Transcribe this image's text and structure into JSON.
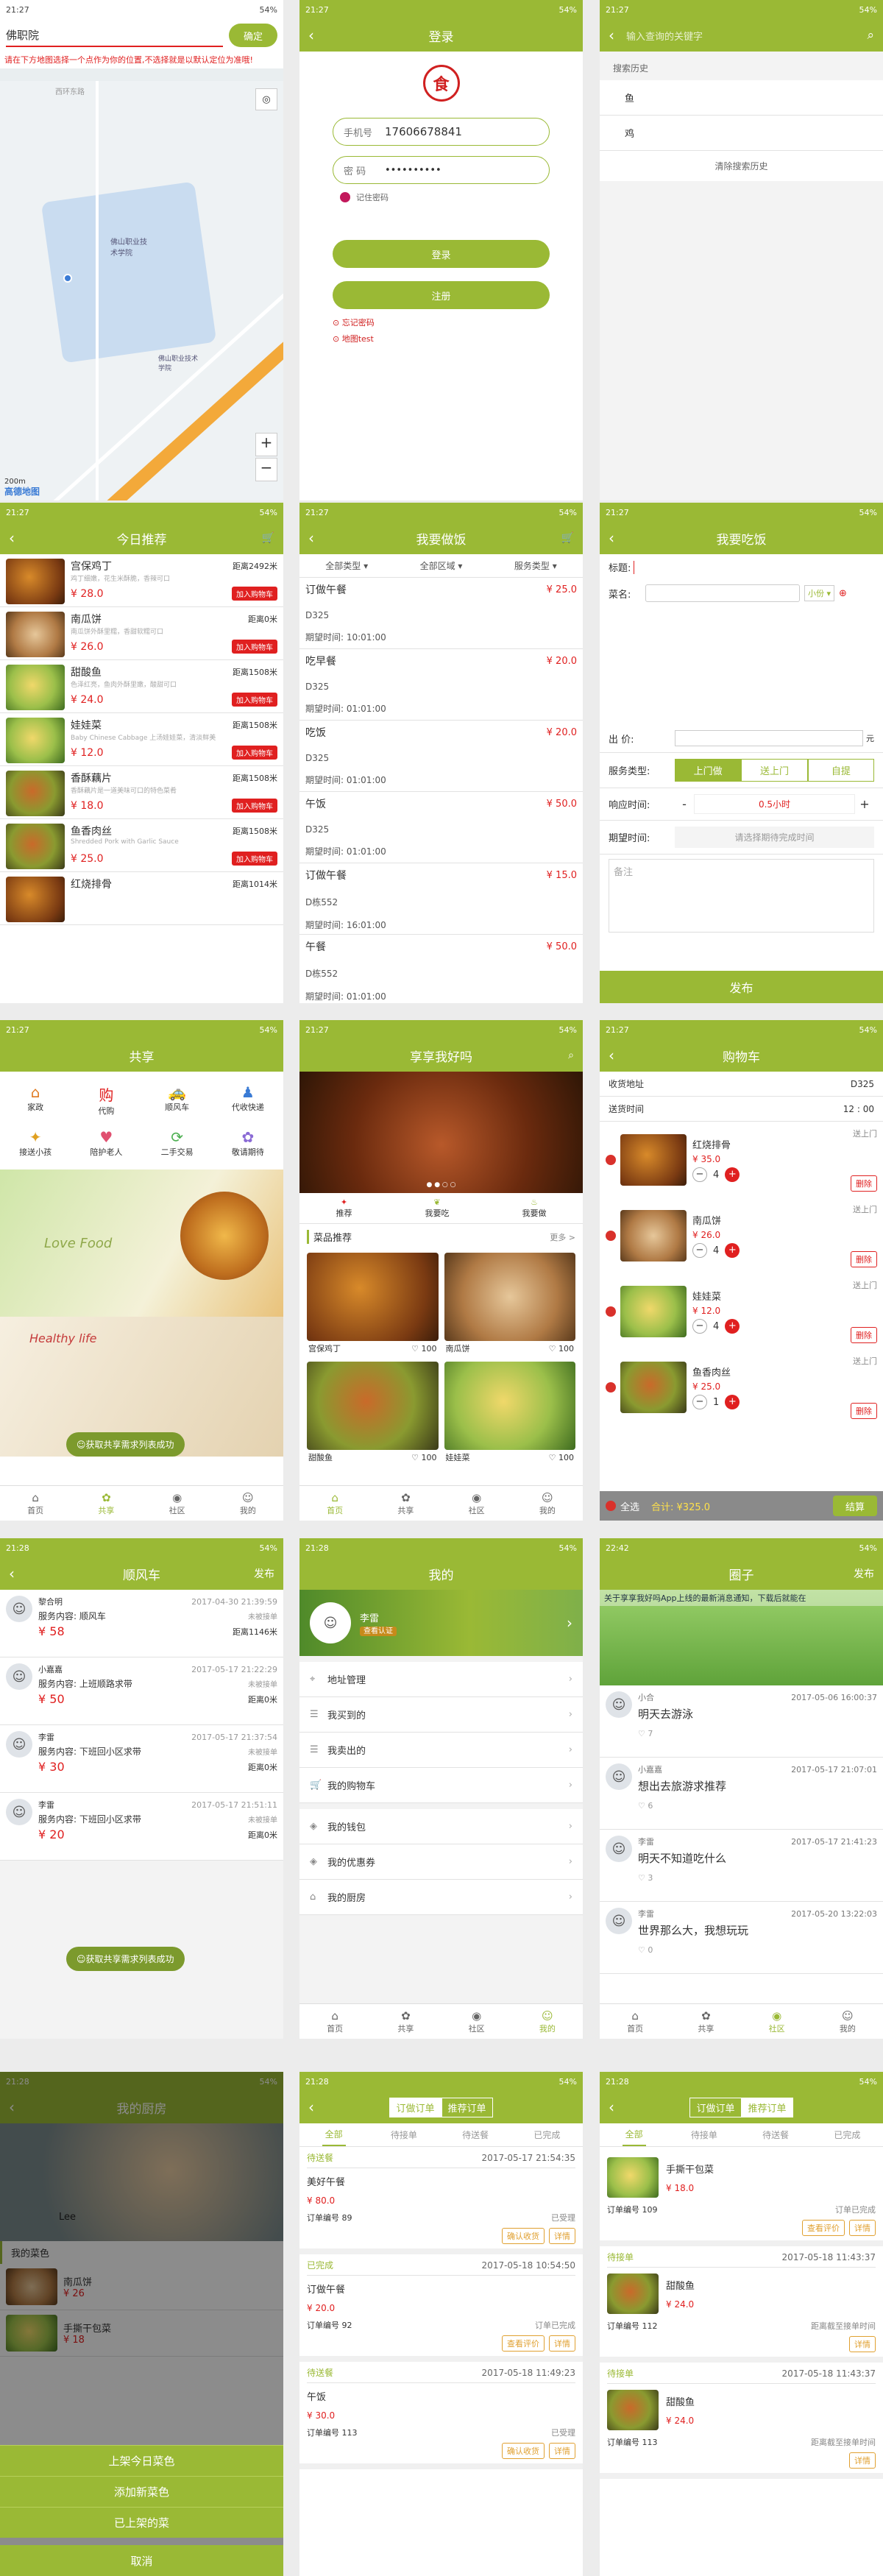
{
  "status": {
    "time": "21:27",
    "battery": "54%",
    "time2": "21:28",
    "time3": "22:42"
  },
  "map": {
    "place": "佛职院",
    "confirm": "确定",
    "hint": "请在下方地图选择一个点作为你的位置,不选择就是以默认定位为准哦!",
    "campus": "佛山职业技术学院",
    "street": "西环东路",
    "scale": "200m",
    "logo": "高德地图",
    "zoom_in": "+",
    "zoom_out": "−",
    "poi": "佛山职业技术学院"
  },
  "login": {
    "title": "登录",
    "phone_label": "手机号",
    "phone": "17606678841",
    "pwd_label": "密 码",
    "pwd": "••••••••••",
    "remember": "记住密码",
    "login_btn": "登录",
    "register_btn": "注册",
    "forgot": "忘记密码",
    "maptest": "地图test",
    "logo": "食"
  },
  "search": {
    "placeholder": "输入查询的关键字",
    "history_title": "搜索历史",
    "items": [
      "鱼",
      "鸡"
    ],
    "clear": "清除搜索历史"
  },
  "rec": {
    "title": "今日推荐",
    "items": [
      {
        "name": "宫保鸡丁",
        "dist": "距离2492米",
        "desc": "鸡丁细嫩，花生米酥脆，香辣可口",
        "price": "¥ 28.0",
        "add": "加入购物车"
      },
      {
        "name": "南瓜饼",
        "dist": "距离0米",
        "desc": "南瓜饼外酥里糯，香甜软糯可口",
        "price": "¥ 26.0",
        "add": "加入购物车"
      },
      {
        "name": "甜酸鱼",
        "dist": "距离1508米",
        "desc": "色泽红亮，鱼肉外酥里嫩，酸甜可口",
        "price": "¥ 24.0",
        "add": "加入购物车"
      },
      {
        "name": "娃娃菜",
        "dist": "距离1508米",
        "desc": "Baby Chinese Cabbage 上汤娃娃菜，清淡鲜美",
        "price": "¥ 12.0",
        "add": "加入购物车"
      },
      {
        "name": "香酥藕片",
        "dist": "距离1508米",
        "desc": "香酥藕片是一道美味可口的特色菜肴",
        "price": "¥ 18.0",
        "add": "加入购物车"
      },
      {
        "name": "鱼香肉丝",
        "dist": "距离1508米",
        "desc": "Shredded Pork with Garlic Sauce",
        "price": "¥ 25.0",
        "add": "加入购物车"
      },
      {
        "name": "红烧排骨",
        "dist": "距离1014米",
        "desc": "",
        "price": "",
        "add": ""
      }
    ]
  },
  "cook": {
    "title": "我要做饭",
    "filters": [
      "全部类型",
      "全部区域",
      "服务类型"
    ],
    "items": [
      {
        "name": "订做午餐",
        "price": "¥ 25.0",
        "room": "D325",
        "time": "期望时间:  10:01:00"
      },
      {
        "name": "吃早餐",
        "price": "¥ 20.0",
        "room": "D325",
        "time": "期望时间:  01:01:00"
      },
      {
        "name": "吃饭",
        "price": "¥ 20.0",
        "room": "D325",
        "time": "期望时间:  01:01:00"
      },
      {
        "name": "午饭",
        "price": "¥ 50.0",
        "room": "D325",
        "time": "期望时间:  01:01:00"
      },
      {
        "name": "订做午餐",
        "price": "¥ 15.0",
        "room": "D栋552",
        "time": "期望时间:  16:01:00"
      },
      {
        "name": "午餐",
        "price": "¥ 50.0",
        "room": "D栋552",
        "time": "期望时间:  01:01:00"
      }
    ]
  },
  "eat": {
    "title": "我要吃饭",
    "title_label": "标题:",
    "dish_label": "菜名:",
    "portion": "小份",
    "price_label": "出    价:",
    "unit": "元",
    "service_label": "服务类型:",
    "services": [
      "上门做",
      "送上门",
      "自提"
    ],
    "resp_label": "响应时间:",
    "resp_value": "0.5小时",
    "minus": "-",
    "plus": "+",
    "expect_label": "期望时间:",
    "expect_placeholder": "请选择期待完成时间",
    "note_placeholder": "备注",
    "publish": "发布"
  },
  "share": {
    "title": "共享",
    "icons": [
      {
        "label": "家政",
        "icon": "⌂"
      },
      {
        "label": "代购",
        "icon": "购"
      },
      {
        "label": "顺风车",
        "icon": "🚕"
      },
      {
        "label": "代收快递",
        "icon": "♟"
      },
      {
        "label": "接送小孩",
        "icon": "✦"
      },
      {
        "label": "陪护老人",
        "icon": "♥"
      },
      {
        "label": "二手交易",
        "icon": "⟳"
      },
      {
        "label": "敬请期待",
        "icon": "✿"
      }
    ],
    "banner1": "Love Food",
    "banner2": "Healthy life",
    "toast": "获取共享需求列表成功"
  },
  "home": {
    "title": "享享我好吗",
    "cats": [
      "推荐",
      "我要吃",
      "我要做"
    ],
    "section": "菜品推荐",
    "more": "更多 >",
    "grid": [
      {
        "name": "宫保鸡丁",
        "likes": "100"
      },
      {
        "name": "南瓜饼",
        "likes": "100"
      },
      {
        "name": "甜酸鱼",
        "likes": "100"
      },
      {
        "name": "娃娃菜",
        "likes": "100"
      }
    ]
  },
  "cart": {
    "title": "购物车",
    "addr_label": "收货地址",
    "addr": "D325",
    "time_label": "送货时间",
    "time": "12 : 00",
    "items": [
      {
        "name": "红烧排骨",
        "type": "送上门",
        "price": "¥ 35.0",
        "qty": "4",
        "del": "删除"
      },
      {
        "name": "南瓜饼",
        "type": "送上门",
        "price": "¥ 26.0",
        "qty": "4",
        "del": "删除"
      },
      {
        "name": "娃娃菜",
        "type": "送上门",
        "price": "¥ 12.0",
        "qty": "4",
        "del": "删除"
      },
      {
        "name": "鱼香肉丝",
        "type": "送上门",
        "price": "¥ 25.0",
        "qty": "1",
        "del": "删除"
      }
    ],
    "all": "全选",
    "total": "合计: ¥325.0",
    "checkout": "结算"
  },
  "ride": {
    "title": "顺风车",
    "publish": "发布",
    "items": [
      {
        "user": "黎合明",
        "time": "2017-04-30 21:39:59",
        "content": "服务内容: 顺风车",
        "status": "未被接单",
        "price": "¥ 58",
        "dist": "距离1146米"
      },
      {
        "user": "小嘉嘉",
        "time": "2017-05-17 21:22:29",
        "content": "服务内容: 上班顺路求带",
        "status": "未被接单",
        "price": "¥ 50",
        "dist": "距离0米"
      },
      {
        "user": "李雷",
        "time": "2017-05-17 21:37:54",
        "content": "服务内容: 下班回小区求带",
        "status": "未被接单",
        "price": "¥ 30",
        "dist": "距离0米"
      },
      {
        "user": "李雷",
        "time": "2017-05-17 21:51:11",
        "content": "服务内容: 下班回小区求带",
        "status": "未被接单",
        "price": "¥ 20",
        "dist": "距离0米"
      }
    ],
    "toast": "获取共享需求列表成功"
  },
  "me": {
    "title": "我的",
    "name": "李雷",
    "tag": "查看认证",
    "menu": [
      "地址管理",
      "我买到的",
      "我卖出的",
      "我的购物车",
      "我的钱包",
      "我的优惠券",
      "我的厨房"
    ]
  },
  "circle": {
    "title": "圈子",
    "publish": "发布",
    "notice": "关于享享我好吗App上线的最新消息通知，下载后就能在",
    "posts": [
      {
        "user": "小合",
        "time": "2017-05-06 16:00:37",
        "text": "明天去游泳",
        "likes": "7"
      },
      {
        "user": "小嘉嘉",
        "time": "2017-05-17 21:07:01",
        "text": "想出去旅游求推荐",
        "likes": "6"
      },
      {
        "user": "李雷",
        "time": "2017-05-17 21:41:23",
        "text": "明天不知道吃什么",
        "likes": "3"
      },
      {
        "user": "李雷",
        "time": "2017-05-20 13:22:03",
        "text": "世界那么大，我想玩玩",
        "likes": "0"
      }
    ]
  },
  "kitchen": {
    "title": "我的厨房",
    "user": "Lee",
    "section": "我的菜色",
    "dishes": [
      {
        "name": "南瓜饼",
        "price": "¥ 26"
      },
      {
        "name": "手撕干包菜",
        "price": "¥ 18"
      }
    ],
    "actions": [
      "上架今日菜色",
      "添加新菜色",
      "已上架的菜"
    ],
    "cancel": "取消"
  },
  "orders1": {
    "tabs": [
      "订做订单",
      "推荐订单"
    ],
    "sub": [
      "全部",
      "待接单",
      "待送餐",
      "已完成"
    ],
    "items": [
      {
        "state": "待送餐",
        "time": "2017-05-17 21:54:35",
        "name": "美好午餐",
        "price": "¥ 80.0",
        "no": "订单编号  89",
        "status": "已受理",
        "b1": "确认收货",
        "b2": "详情"
      },
      {
        "state": "已完成",
        "time": "2017-05-18 10:54:50",
        "name": "订做午餐",
        "price": "¥ 20.0",
        "no": "订单编号  92",
        "status": "订单已完成",
        "b1": "查看评价",
        "b2": "详情"
      },
      {
        "state": "待送餐",
        "time": "2017-05-18 11:49:23",
        "name": "午饭",
        "price": "¥ 30.0",
        "no": "订单编号  113",
        "status": "已受理",
        "b1": "确认收货",
        "b2": "详情"
      }
    ]
  },
  "orders2": {
    "tabs": [
      "订做订单",
      "推荐订单"
    ],
    "sub": [
      "全部",
      "待接单",
      "待送餐",
      "已完成"
    ],
    "items": [
      {
        "state": "",
        "time": "",
        "name": "手撕干包菜",
        "price": "¥ 18.0",
        "no": "订单编号  109",
        "status": "订单已完成",
        "b1": "查看评价",
        "b2": "详情"
      },
      {
        "state": "待接单",
        "time": "2017-05-18 11:43:37",
        "name": "甜酸鱼",
        "price": "¥ 24.0",
        "no": "订单编号  112",
        "status": "距离截至接单时间",
        "b1": "",
        "b2": "详情"
      },
      {
        "state": "待接单",
        "time": "2017-05-18 11:43:37",
        "name": "甜酸鱼",
        "price": "¥ 24.0",
        "no": "订单编号  113",
        "status": "距离截至接单时间",
        "b1": "",
        "b2": "详情"
      }
    ]
  },
  "tabs": [
    "首页",
    "共享",
    "社区",
    "我的"
  ],
  "colors": {
    "accent": "#9ab935",
    "price": "#e02020"
  }
}
